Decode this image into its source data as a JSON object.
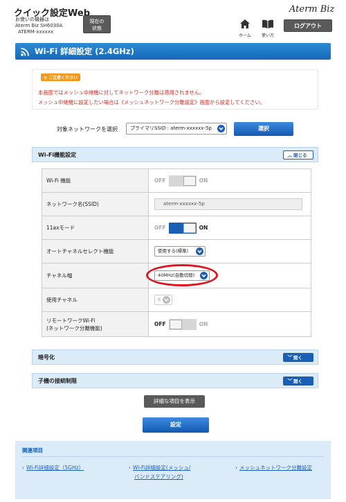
{
  "header": {
    "app_title": "クイック設定Web",
    "device_caption": "お使いの機器は",
    "device_model": "Aterm Biz SH6030A",
    "device_name": "ATERM-xxxxxx",
    "status_button": "現在の状態",
    "home_label": "ホーム",
    "help_label": "使い方",
    "logo": "Aterm Biz",
    "logout_button": "ログアウト"
  },
  "page": {
    "title": "Wi-Fi 詳細設定 (2.4GHz)"
  },
  "notice": {
    "badge": "ご注意ください",
    "line1": "本画面ではメッシュ中継機に対してネットワーク分離は適用されません。",
    "line2": "メッシュ中継機に設定したい場合は《メッシュネットワーク分離設定》画面から設定してください。"
  },
  "network_select": {
    "label": "対象ネットワークを選択",
    "value": "プライマリSSID : aterm-xxxxxx-5p",
    "button": "選択"
  },
  "wifi_section": {
    "title": "Wi-Fi機能設定",
    "toggle_button": "閉じる",
    "rows": [
      {
        "label": "Wi-Fi 機能",
        "off": "OFF",
        "on": "ON",
        "state": "on"
      },
      {
        "label": "ネットワーク名(SSID)",
        "value": "aterm-xxxxxx-5p"
      },
      {
        "label": "11axモード",
        "off": "OFF",
        "on": "ON",
        "state": "on"
      },
      {
        "label": "オートチャネルセレクト機能",
        "value": "使用する(標準)"
      },
      {
        "label": "チャネル幅",
        "value": "40MHz(自動切替)"
      },
      {
        "label": "使用チャネル",
        "value": "6"
      },
      {
        "label_line1": "リモートワークWi-Fi",
        "label_line2": "(ネットワーク分離機能)",
        "off": "OFF",
        "on": "ON",
        "state": "off"
      }
    ]
  },
  "encryption_section": {
    "title": "暗号化",
    "toggle_button": "開く"
  },
  "child_section": {
    "title": "子機の接続制限",
    "toggle_button": "開く"
  },
  "buttons": {
    "detail": "詳細な項目を表示",
    "submit": "設定"
  },
  "related": {
    "title": "関連項目",
    "links": [
      {
        "line1": "Wi-Fi詳細設定（5GHz）",
        "line2": ""
      },
      {
        "line1": "Wi-Fi詳細設定(メッシュ/",
        "line2": "バンドステアリング)"
      },
      {
        "line1": "メッシュネットワーク分離設定",
        "line2": ""
      }
    ]
  },
  "colors": {
    "accent_blue": "#1a5fb4",
    "notice_red": "#c8322b",
    "badge_orange": "#f19a1f",
    "highlight_red": "#e0141e"
  }
}
